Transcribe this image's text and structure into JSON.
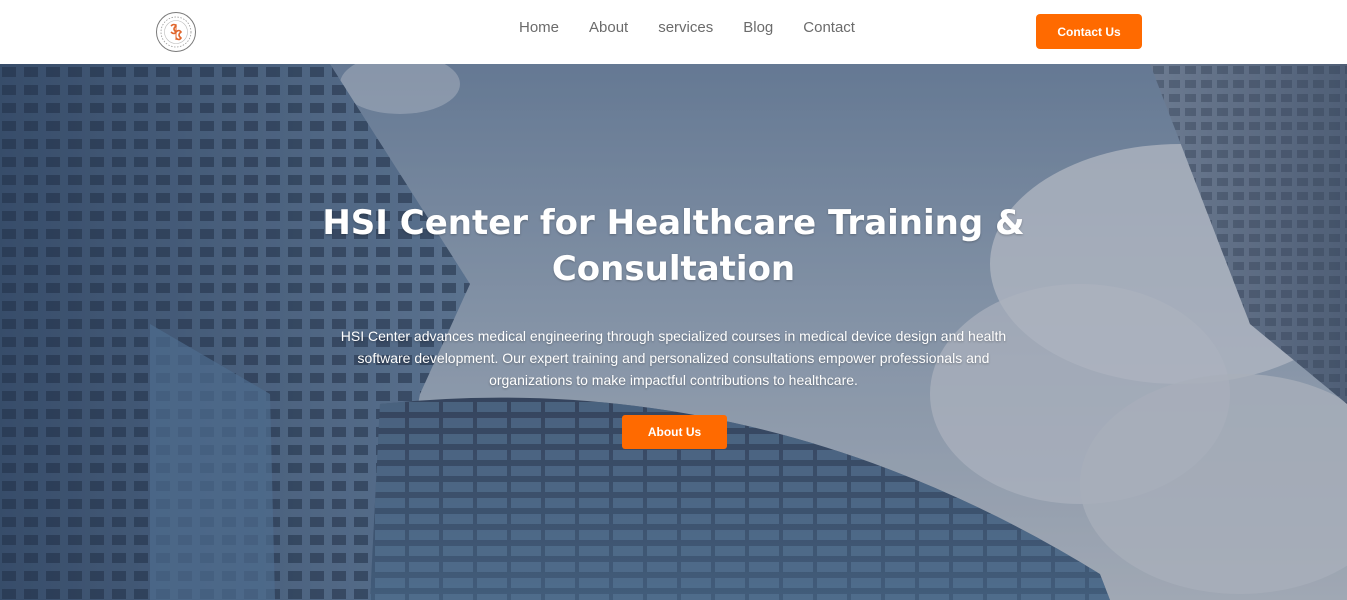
{
  "header": {
    "logo_icon": "hsi-logo-icon",
    "nav": [
      {
        "label": "Home"
      },
      {
        "label": "About"
      },
      {
        "label": "services"
      },
      {
        "label": "Blog"
      },
      {
        "label": "Contact"
      }
    ],
    "contact_button": "Contact Us"
  },
  "hero": {
    "title": "HSI Center for Healthcare Training & Consultation",
    "description": "HSI Center advances medical engineering through specialized courses in medical device design and health software development. Our expert training and personalized consultations empower professionals and organizations to make impactful contributions to healthcare.",
    "button": "About Us"
  },
  "colors": {
    "accent": "#ff6a00",
    "nav_text": "#6b6b6b"
  }
}
